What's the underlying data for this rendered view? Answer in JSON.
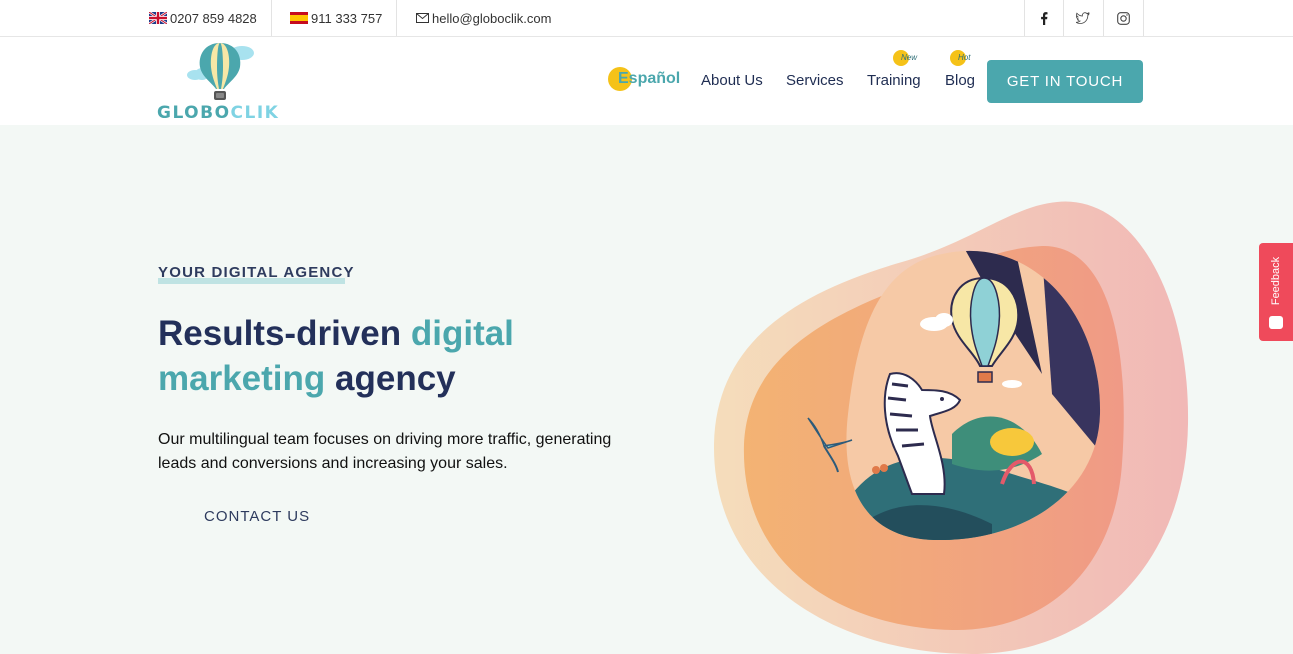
{
  "topbar": {
    "phone_uk": "0207 859 4828",
    "phone_es": "911 333 757",
    "email": "hello@globoclik.com",
    "social": [
      "facebook-icon",
      "twitter-icon",
      "instagram-icon"
    ]
  },
  "logo": {
    "part1": "GLOBO",
    "part2": "CLIK"
  },
  "nav": {
    "language": "Español",
    "about": "About Us",
    "services": "Services",
    "training": "Training",
    "training_badge": "New",
    "blog": "Blog",
    "blog_badge": "Hot",
    "cta": "GET IN TOUCH"
  },
  "hero": {
    "eyebrow": "YOUR DIGITAL AGENCY",
    "headline_1": "Results-driven ",
    "headline_2": "digital marketing",
    "headline_3": " agency",
    "description": "Our multilingual team focuses on driving more traffic, generating leads and conversions and increasing your sales.",
    "contact": "CONTACT US"
  },
  "feedback": {
    "label": "Feedback"
  },
  "colors": {
    "accent": "#4ba7ad",
    "navy": "#23305a",
    "hero_bg": "#f3f8f5",
    "feedback": "#ef4a5b",
    "sun": "#f5c218"
  }
}
